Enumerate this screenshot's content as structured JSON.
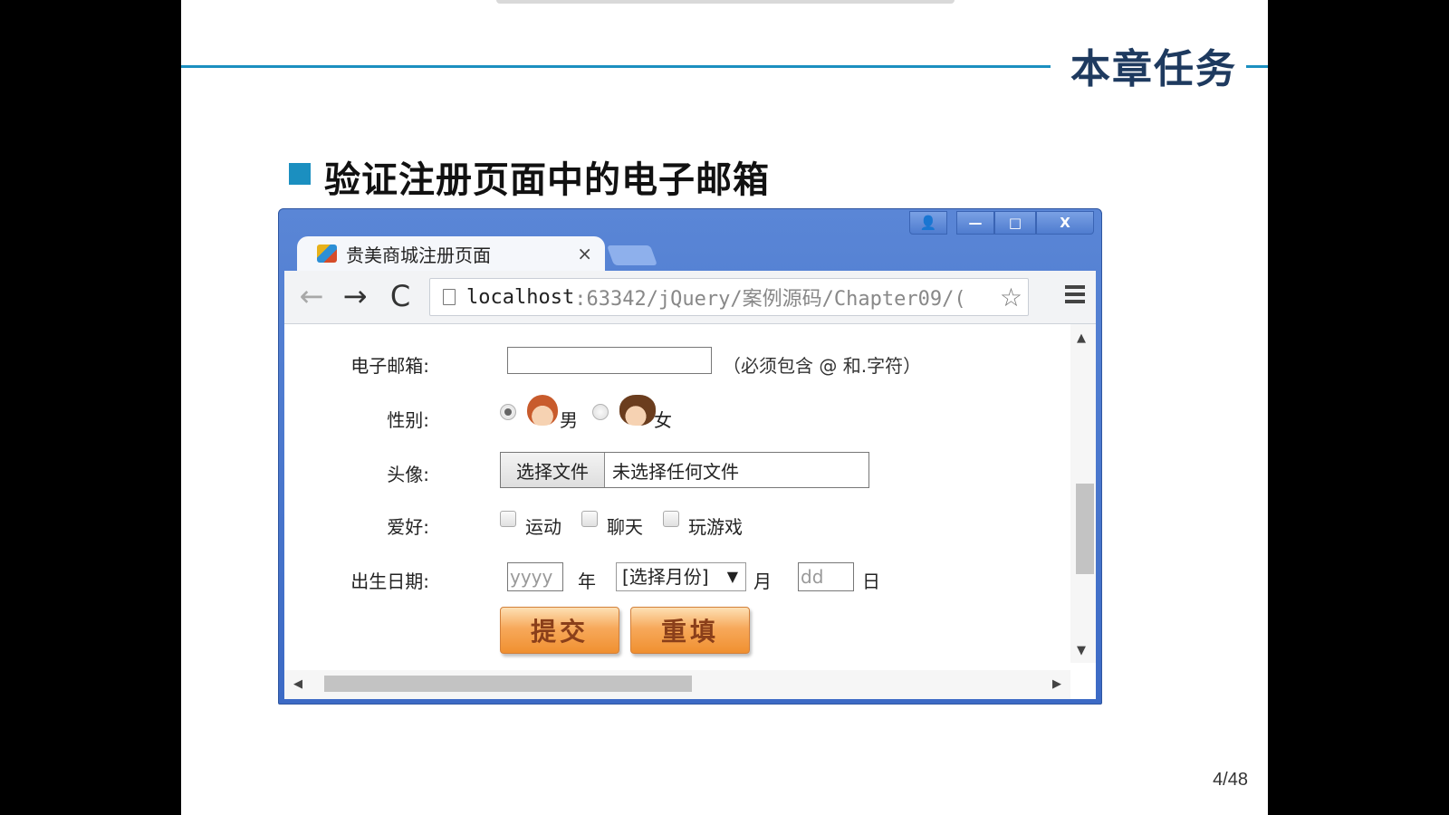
{
  "slide": {
    "title": "本章任务",
    "subtitle": "验证注册页面中的电子邮箱",
    "page_number": "4/48"
  },
  "browser": {
    "tab_title": "贵美商城注册页面",
    "tab_close": "×",
    "window_controls": {
      "user": "👤",
      "minimize": "—",
      "maximize": "□",
      "close": "X"
    },
    "address": {
      "host": "localhost",
      "path": ":63342/jQuery/案例源码/Chapter09/("
    },
    "nav": {
      "back": "←",
      "forward": "→",
      "reload": "C"
    },
    "star": "☆"
  },
  "form": {
    "email": {
      "label": "电子邮箱:",
      "value": "",
      "hint": "（必须包含 @ 和.字符）"
    },
    "gender": {
      "label": "性别:",
      "options": [
        "男",
        "女"
      ],
      "selected": "男"
    },
    "avatar": {
      "label": "头像:",
      "button": "选择文件",
      "status": "未选择任何文件"
    },
    "hobbies": {
      "label": "爱好:",
      "options": [
        "运动",
        "聊天",
        "玩游戏"
      ]
    },
    "birthday": {
      "label": "出生日期:",
      "year_placeholder": "yyyy",
      "year_unit": "年",
      "month_select": "[选择月份]",
      "month_unit": "月",
      "day_placeholder": "dd",
      "day_unit": "日"
    },
    "buttons": {
      "submit": "提交",
      "reset": "重填"
    }
  },
  "scrollbars": {
    "up": "▲",
    "down": "▼",
    "left": "◀",
    "right": "▶"
  },
  "colors": {
    "accent": "#1b8fc0",
    "title": "#1e3a5f",
    "browser_frame": "#3c6ac5",
    "button_orange": "#f09030"
  }
}
